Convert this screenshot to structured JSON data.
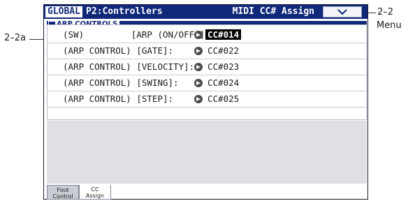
{
  "window": {
    "mode": "GLOBAL",
    "page": "P2:Controllers",
    "title": "MIDI CC# Assign"
  },
  "group": {
    "label": "ARP CONTROLS"
  },
  "rows": [
    {
      "label": "(SW)         [ARP (ON/OFF)]:",
      "value": "CC#014"
    },
    {
      "label": "(ARP CONTROL) [GATE]:",
      "value": "CC#022"
    },
    {
      "label": "(ARP CONTROL) [VELOCITY]:",
      "value": "CC#023"
    },
    {
      "label": "(ARP CONTROL) [SWING]:",
      "value": "CC#024"
    },
    {
      "label": "(ARP CONTROL) [STEP]:",
      "value": "CC#025"
    }
  ],
  "tabs": [
    {
      "line1": "Foot",
      "line2": "Control"
    },
    {
      "line1": "CC",
      "line2": "Assign"
    }
  ],
  "callouts": {
    "menu_number": "2–2",
    "menu_word": "Menu",
    "row_ref": "2–2a"
  },
  "colors": {
    "titlebar": "#10287a",
    "selected": "#000000"
  },
  "icons": {
    "menu": "chevron-down-icon",
    "value_arrow": "right-arrow-circle-icon"
  }
}
